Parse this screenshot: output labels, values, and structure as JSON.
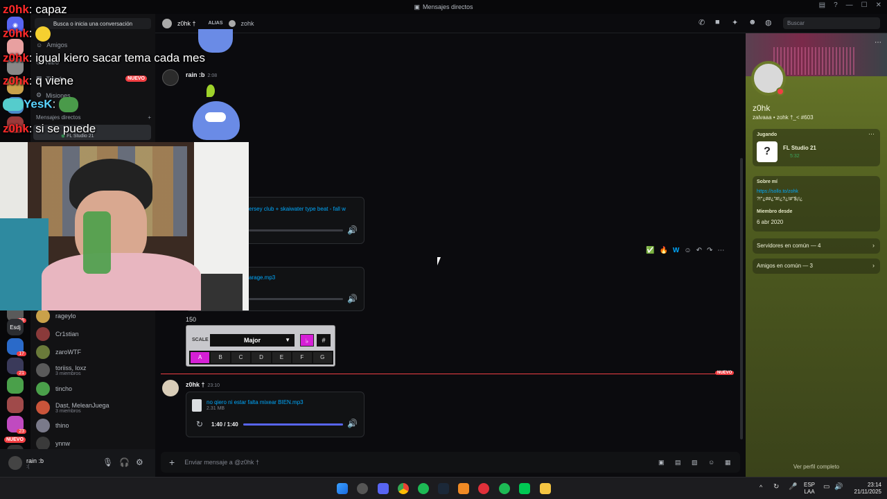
{
  "window": {
    "title": "Mensajes directos"
  },
  "sidebar": {
    "search_placeholder": "Busca o inicia una conversación",
    "nav": [
      {
        "label": "Amigos"
      },
      {
        "label": "Nitro"
      },
      {
        "label": "Tienda",
        "badge": "NUEVO"
      },
      {
        "label": "Misiones"
      }
    ],
    "section_title": "Mensajes directos",
    "active_activity": "FL Studio 21",
    "dms": [
      {
        "name": "rageylo",
        "sub": ""
      },
      {
        "name": "Cr1stian",
        "sub": ""
      },
      {
        "name": "zaroWTF",
        "sub": ""
      },
      {
        "name": "toriiss, loxz",
        "sub": "3 miembros"
      },
      {
        "name": "tincho",
        "sub": ""
      },
      {
        "name": "Dast, MeleanJuega",
        "sub": "3 miembros"
      },
      {
        "name": "thino",
        "sub": ""
      },
      {
        "name": "ynnw",
        "sub": ""
      }
    ],
    "rail_labels": {
      "esdj": "Esdj",
      "nuevo": "NUEVO"
    },
    "rail_badges": [
      "56",
      "17",
      "21",
      "23"
    ]
  },
  "user": {
    "name": "rain :b",
    "status": ":("
  },
  "header": {
    "name": "z0hk †",
    "alias_label": "ALIAS",
    "alias": "zohk",
    "search_placeholder": "Buscar"
  },
  "chat": {
    "msg1": {
      "author": "rain :b",
      "time": "2:08"
    },
    "audio1": {
      "filename": "ersey club + skaiwater type beat - fall w"
    },
    "audio2": {
      "filename": "arage.mp3"
    },
    "bpm_text": "150",
    "scale_widget": {
      "label": "SCALE",
      "value": "Major",
      "flat": "♭",
      "sharp": "#",
      "notes": [
        "A",
        "B",
        "C",
        "D",
        "E",
        "F",
        "G"
      ],
      "active_note": "A"
    },
    "new_divider": "NUEVO",
    "msg2": {
      "author": "z0hk †",
      "time": "23:10"
    },
    "audio3": {
      "filename": "no qiero ni estar falta mixear BIEN.mp3",
      "size": "2.31 MB",
      "time": "1:40 / 1:40",
      "progress": 1.0
    },
    "composer_placeholder": "Enviar mensaje a @z0hk †"
  },
  "profile": {
    "display_name": "z0hk",
    "tag_line": "zalvaaa • zohk †_< #603",
    "playing_label": "Jugando",
    "game": "FL Studio 21",
    "game_time": "5:32",
    "about_label": "Sobre mí",
    "about_link": "https://sollo.to/zohk",
    "about_text": "?!\"¿##¿\"#!¿?¿!#\"$¡!¿",
    "member_since_label": "Miembro desde",
    "member_since": "6 abr 2020",
    "servers_common": "Servidores en común — 4",
    "friends_common": "Amigos en común — 3",
    "full_profile": "Ver perfil completo"
  },
  "overlay_chat": [
    {
      "user": "z0hk",
      "text": "capaz"
    },
    {
      "user": "z0hk",
      "text": ""
    },
    {
      "user": "z0hk",
      "text": "igual kiero sacar tema cada mes"
    },
    {
      "user": "z0hk",
      "text": "q viene"
    },
    {
      "user": "YesK",
      "text": ""
    },
    {
      "user": "z0hk",
      "text": "si se puede"
    }
  ],
  "taskbar": {
    "lang1": "ESP",
    "lang2": "LAA",
    "time": "23:14",
    "date": "21/11/2025"
  },
  "colors": {
    "accent": "#5865f2",
    "link": "#00a8fc",
    "danger": "#f23f43",
    "scale_pink": "#d61fd6"
  }
}
